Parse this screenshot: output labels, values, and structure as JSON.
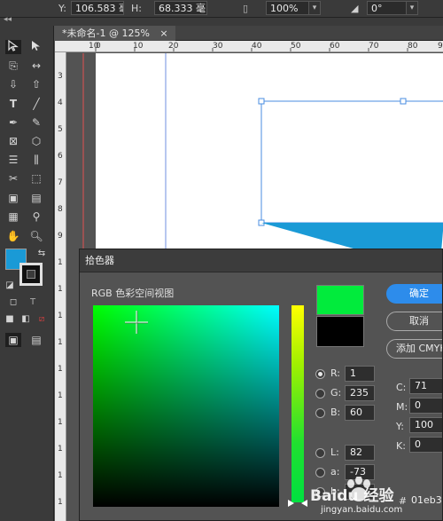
{
  "controlbar": {
    "y_label": "Y:",
    "y_value": "106.583 毫",
    "h_label": "H:",
    "h_value": "68.333 毫",
    "zoom_value": "100%",
    "rotate_value": "0°"
  },
  "tab": {
    "title": "*未命名-1 @ 125%",
    "close": "×"
  },
  "ruler": {
    "h_ticks": [
      "10",
      "0",
      "10",
      "20",
      "30",
      "40",
      "50",
      "60",
      "70",
      "80",
      "90"
    ],
    "v_ticks": [
      "3",
      "4",
      "5",
      "6",
      "7",
      "8",
      "9",
      "1",
      "1",
      "1",
      "1",
      "1",
      "1",
      "1",
      "1",
      "1",
      "1"
    ]
  },
  "tools": {
    "fill_color": "#1a9ad6",
    "stroke_color": "#111111",
    "text_tool_label": "T"
  },
  "dialog": {
    "title": "拾色器",
    "view_label": "RGB 色彩空间视图",
    "new_color": "#01eb3c",
    "old_color": "#000000",
    "ok_label": "确定",
    "cancel_label": "取消",
    "add_label": "添加 CMYK",
    "rgb": {
      "r_label": "R:",
      "r_value": "1",
      "g_label": "G:",
      "g_value": "235",
      "b_label": "B:",
      "b_value": "60"
    },
    "lab": {
      "l_label": "L:",
      "l_value": "82",
      "a_label": "a:",
      "a_value": "-73",
      "b_label": "b:"
    },
    "cmyk": {
      "c_label": "C:",
      "c_value": "71",
      "m_label": "M:",
      "m_value": "0",
      "y_label": "Y:",
      "y_value": "100",
      "k_label": "K:",
      "k_value": "0"
    },
    "hex_label": "#",
    "hex_value": "01eb3c"
  },
  "watermark": {
    "brand": "Baidu 经验",
    "url": "jingyan.baidu.com"
  }
}
